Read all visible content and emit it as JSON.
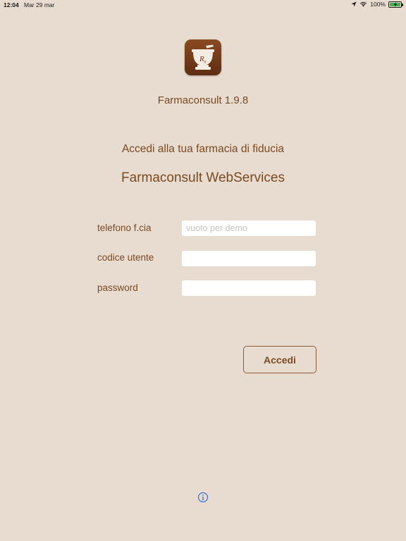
{
  "status_bar": {
    "time": "12:04",
    "date": "Mar 29 mar",
    "battery": "100%"
  },
  "app": {
    "logo_icon": "mortar-pestle-rx-icon",
    "title_version": "Farmaconsult 1.9.8",
    "subtitle": "Accedi alla tua farmacia di fiducia",
    "service_name": "Farmaconsult WebServices"
  },
  "form": {
    "phone_label": "telefono f.cia",
    "phone_placeholder": "vuoto per demo",
    "phone_value": "",
    "user_code_label": "codice utente",
    "user_code_value": "",
    "password_label": "password",
    "password_value": "",
    "login_label": "Accedi"
  },
  "footer": {
    "info_icon": "info-icon"
  },
  "colors": {
    "background": "#e8dbd0",
    "accent": "#7a4a22",
    "logo": "#6e3618",
    "info_icon": "#3a6fd8"
  }
}
